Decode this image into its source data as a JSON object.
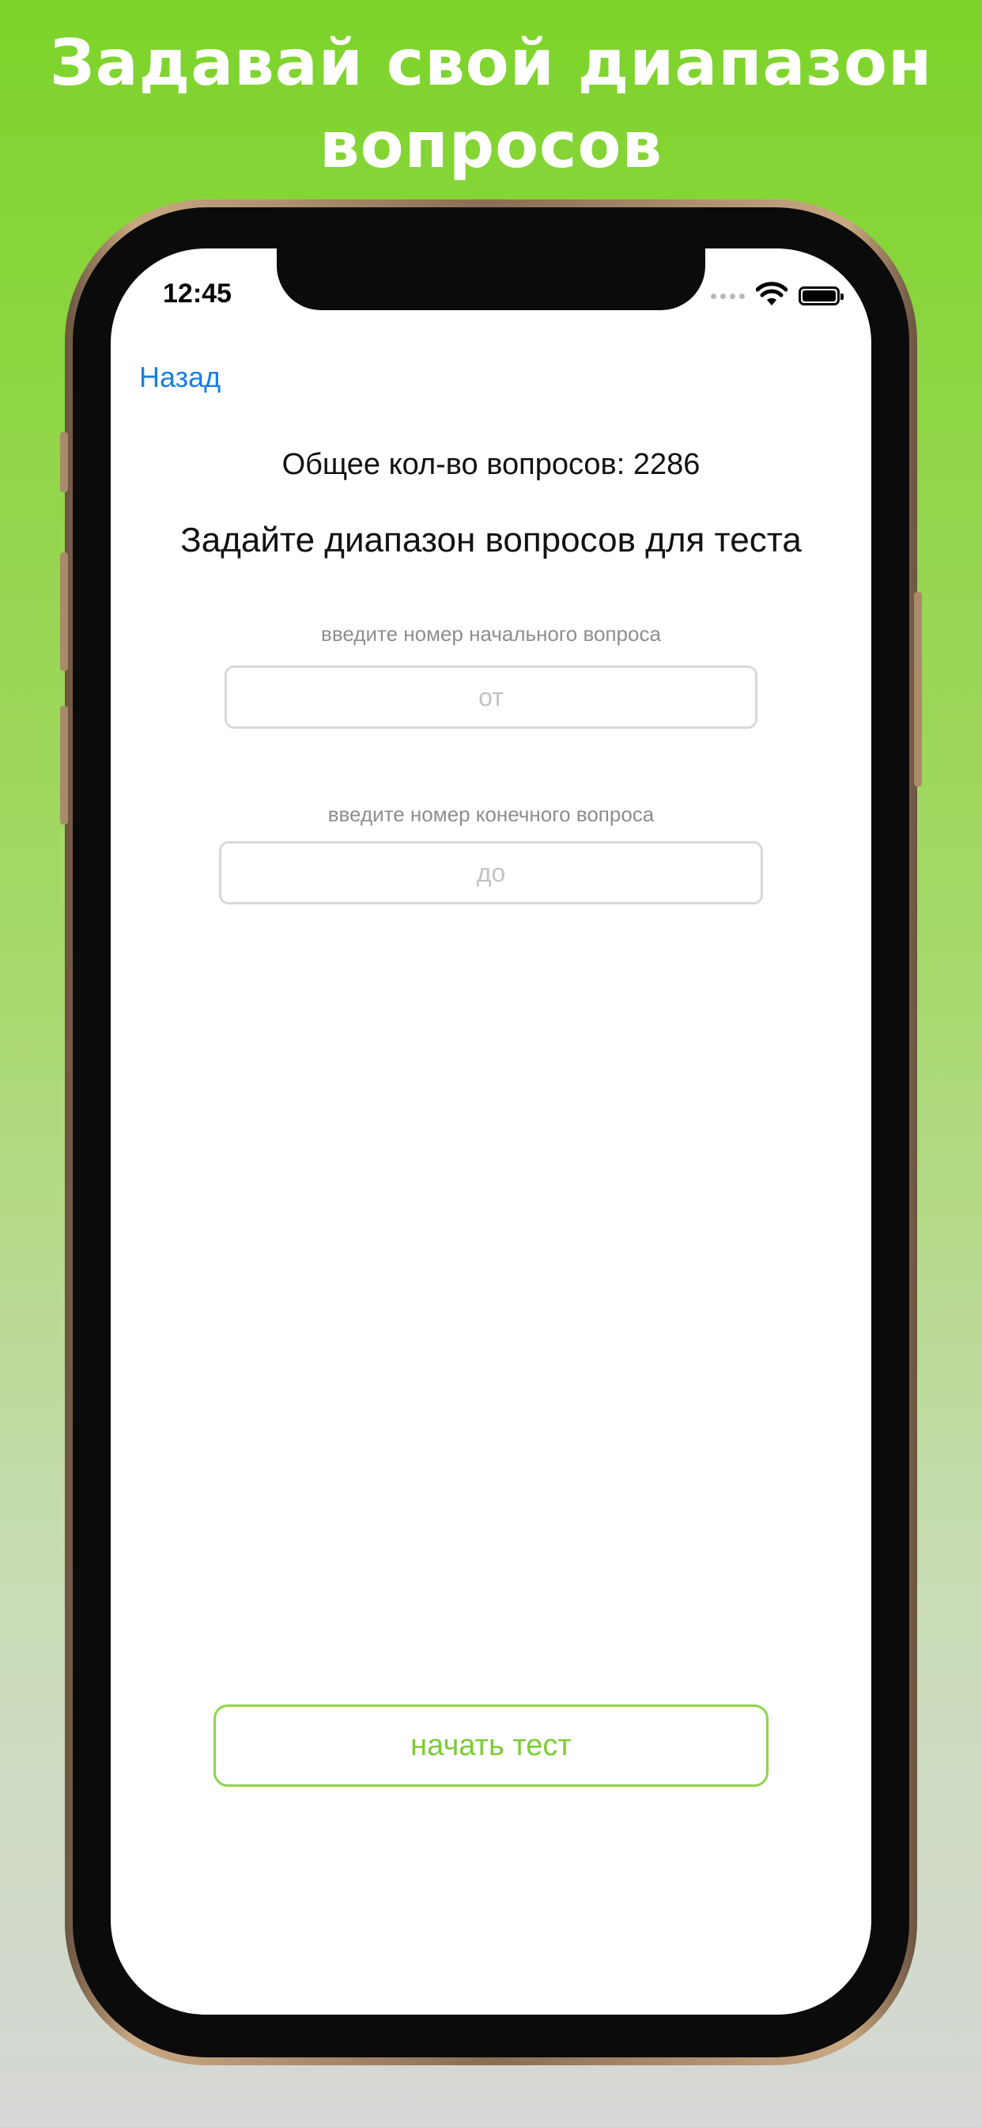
{
  "headline": {
    "line1": "Задавай свой диапазон",
    "line2": "вопросов"
  },
  "status_bar": {
    "time": "12:45",
    "icons": [
      "cellular-signal-icon",
      "wifi-icon",
      "battery-icon"
    ]
  },
  "nav": {
    "back_label": "Назад"
  },
  "main": {
    "total_text": "Общее кол-во вопросов: 2286",
    "title": "Задайте диапазон вопросов для теста",
    "start_field": {
      "hint": "введите номер начального вопроса",
      "placeholder": "от",
      "value": ""
    },
    "end_field": {
      "hint": "введите номер конечного вопроса",
      "placeholder": "до",
      "value": ""
    },
    "start_button_label": "начать тест"
  },
  "colors": {
    "background_top": "#7dd42a",
    "background_bottom": "#d6d8d6",
    "link": "#1a7fe0",
    "accent": "#7ccc36",
    "text": "#111111"
  }
}
